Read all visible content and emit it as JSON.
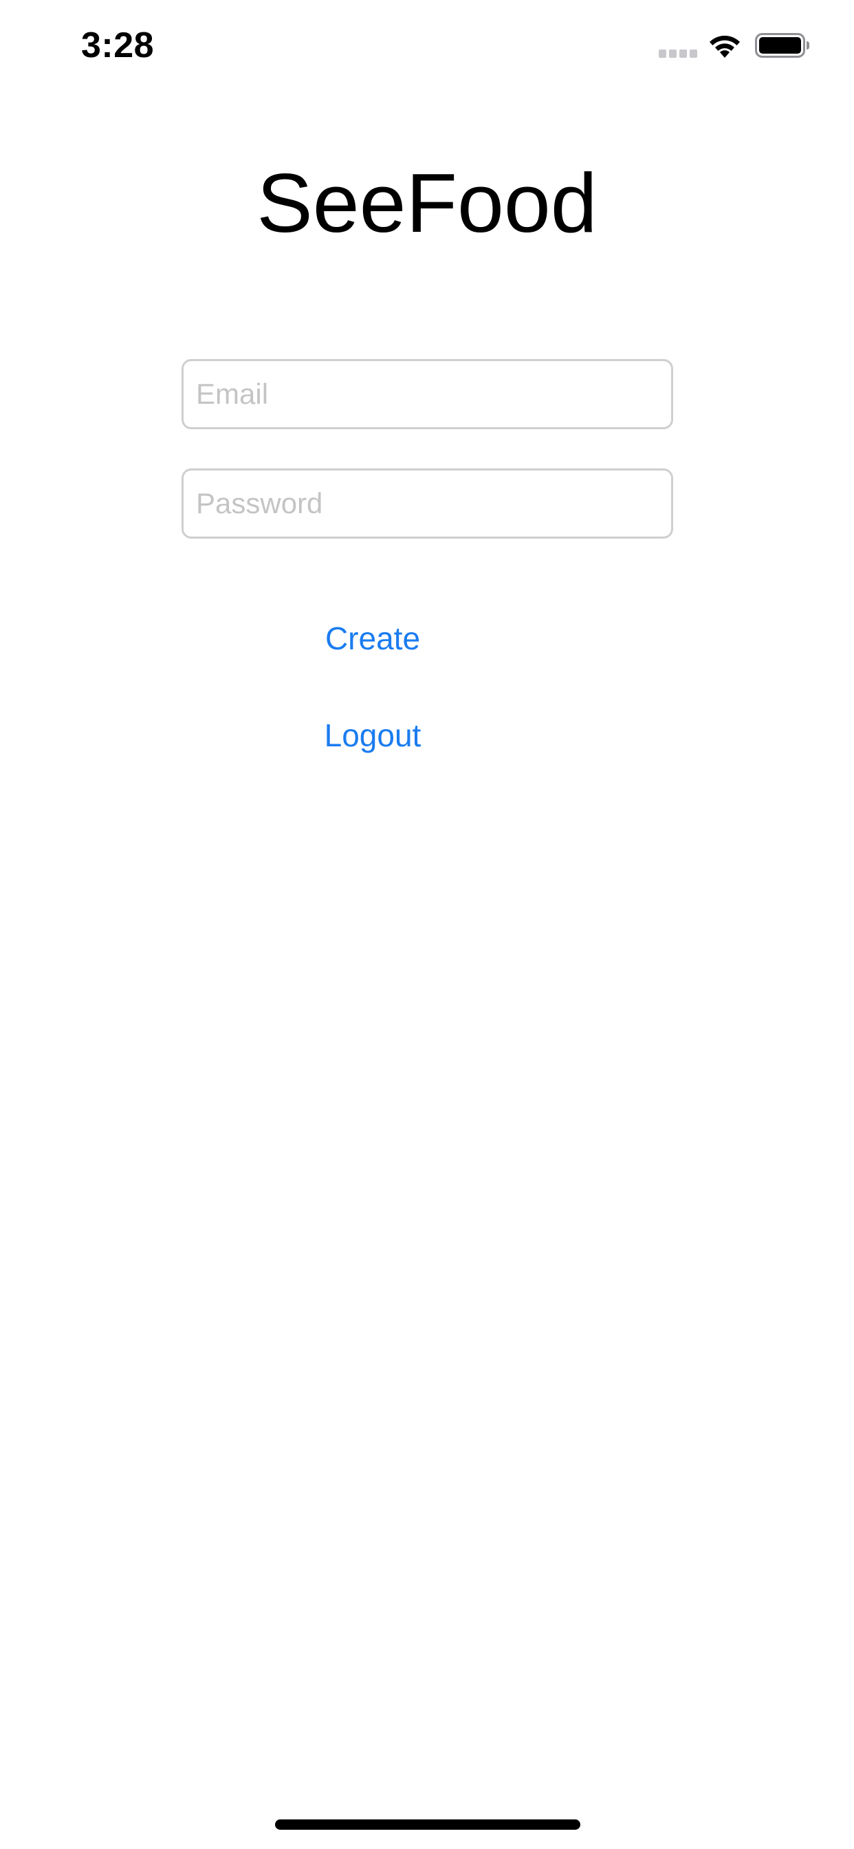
{
  "status_bar": {
    "time": "3:28",
    "signal_icon": "cellular-signal-icon",
    "wifi_icon": "wifi-icon",
    "battery_icon": "battery-icon"
  },
  "app": {
    "title": "SeeFood"
  },
  "form": {
    "email": {
      "value": "",
      "placeholder": "Email"
    },
    "password": {
      "value": "",
      "placeholder": "Password"
    }
  },
  "actions": {
    "create_label": "Create",
    "logout_label": "Logout"
  },
  "colors": {
    "accent": "#1a7cf0",
    "field_border": "#cfcfcf",
    "placeholder": "#c4c4c6",
    "background": "#ffffff"
  }
}
